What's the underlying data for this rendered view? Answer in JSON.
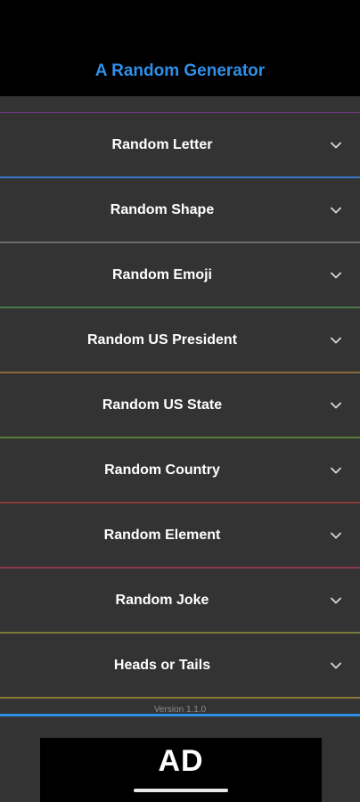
{
  "header": {
    "title": "A Random Generator",
    "title_color": "#2f8fe8"
  },
  "list": {
    "top_line_color": "#7a3a8a",
    "items": [
      {
        "label": "Random Letter",
        "line_color": "#3a78c8",
        "icon": "chevron-down-icon"
      },
      {
        "label": "Random Shape",
        "line_color": "#6a6a6a",
        "icon": "chevron-down-icon"
      },
      {
        "label": "Random Emoji",
        "line_color": "#4a7a4a",
        "icon": "chevron-down-icon"
      },
      {
        "label": "Random US President",
        "line_color": "#8a6a3a",
        "icon": "chevron-down-icon"
      },
      {
        "label": "Random US State",
        "line_color": "#5a7a3a",
        "icon": "chevron-down-icon"
      },
      {
        "label": "Random Country",
        "line_color": "#8a3a3a",
        "icon": "chevron-down-icon"
      },
      {
        "label": "Random Element",
        "line_color": "#8a3a4a",
        "icon": "chevron-down-icon"
      },
      {
        "label": "Random Joke",
        "line_color": "#7a7a3a",
        "icon": "chevron-down-icon"
      },
      {
        "label": "Heads or Tails",
        "line_color": "#8a7a3a",
        "icon": "chevron-down-icon"
      }
    ]
  },
  "footer": {
    "version": "Version 1.1.0",
    "bar_color": "#2f8fe8",
    "ad_logo": "AD"
  }
}
